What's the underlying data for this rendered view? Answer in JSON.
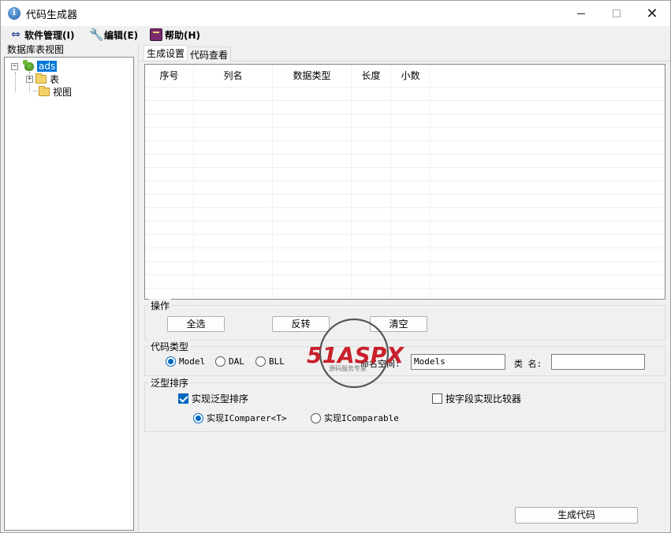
{
  "window": {
    "title": "代码生成器",
    "controls": {
      "minimize": "",
      "maximize": "",
      "close": "✕"
    }
  },
  "menu": [
    {
      "label": "软件管理(I)",
      "icon": "software-icon"
    },
    {
      "label": "编辑(E)",
      "icon": "wrench-icon"
    },
    {
      "label": "帮助(H)",
      "icon": "book-icon"
    }
  ],
  "left_panel": {
    "title": "数据库表视图",
    "tree": {
      "root": {
        "label": "ads",
        "expander": "−",
        "selected": true
      },
      "children": [
        {
          "label": "表",
          "expander": "+"
        },
        {
          "label": "视图"
        }
      ]
    }
  },
  "tabs": [
    {
      "label": "生成设置",
      "active": true
    },
    {
      "label": "代码查看",
      "active": false
    }
  ],
  "grid": {
    "columns": [
      "序号",
      "列名",
      "数据类型",
      "长度",
      "小数"
    ],
    "rows": []
  },
  "operations": {
    "title": "操作",
    "buttons": [
      "全选",
      "反转",
      "清空"
    ]
  },
  "code_type": {
    "title": "代码类型",
    "options": [
      "Model",
      "DAL",
      "BLL"
    ],
    "selected": "Model",
    "namespace_label": "命名空间:",
    "namespace_value": "Models",
    "class_label": "类 名:",
    "class_value": ""
  },
  "generic_sort": {
    "title": "泛型排序",
    "implement_generic_label": "实现泛型排序",
    "implement_generic_checked": true,
    "field_comparer_label": "按字段实现比较器",
    "field_comparer_checked": false,
    "options": [
      "实现IComparer<T>",
      "实现IComparable"
    ],
    "selected": "实现IComparer<T>"
  },
  "generate_button": "生成代码",
  "watermark": {
    "brand": "51ASPX",
    "tagline": "源码服务专家"
  },
  "colors": {
    "accent": "#0067c0",
    "selection": "#0078d7",
    "watermark_red": "#c8202c"
  }
}
